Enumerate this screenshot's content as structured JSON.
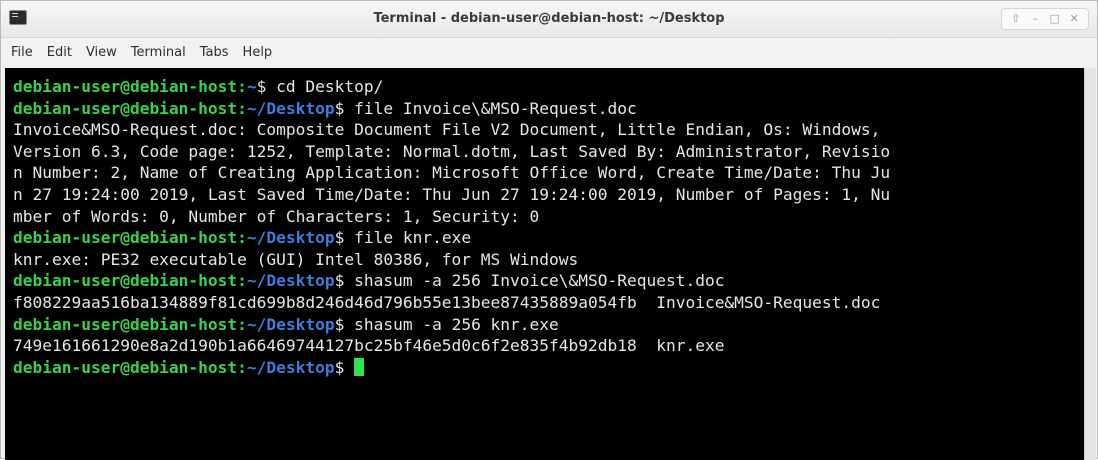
{
  "window": {
    "title": "Terminal - debian-user@debian-host: ~/Desktop",
    "controls": [
      "up-arrow-icon",
      "minimize-icon",
      "maximize-icon",
      "close-icon"
    ]
  },
  "menubar": {
    "items": [
      "File",
      "Edit",
      "View",
      "Terminal",
      "Tabs",
      "Help"
    ]
  },
  "terminal": {
    "colors": {
      "prompt_user": "#37d34a",
      "prompt_path": "#3a7fe0",
      "text": "#e6e6e6",
      "background": "#000000",
      "cursor": "#2fe54b"
    },
    "lines": [
      {
        "type": "prompt",
        "user": "debian-user@debian-host:",
        "path": "~",
        "cmd": "$ cd Desktop/"
      },
      {
        "type": "prompt",
        "user": "debian-user@debian-host:",
        "path": "~/Desktop",
        "cmd": "$ file Invoice\\&MSO-Request.doc"
      },
      {
        "type": "output",
        "text": "Invoice&MSO-Request.doc: Composite Document File V2 Document, Little Endian, Os: Windows,"
      },
      {
        "type": "output",
        "text": "Version 6.3, Code page: 1252, Template: Normal.dotm, Last Saved By: Administrator, Revisio"
      },
      {
        "type": "output",
        "text": "n Number: 2, Name of Creating Application: Microsoft Office Word, Create Time/Date: Thu Ju"
      },
      {
        "type": "output",
        "text": "n 27 19:24:00 2019, Last Saved Time/Date: Thu Jun 27 19:24:00 2019, Number of Pages: 1, Nu"
      },
      {
        "type": "output",
        "text": "mber of Words: 0, Number of Characters: 1, Security: 0"
      },
      {
        "type": "prompt",
        "user": "debian-user@debian-host:",
        "path": "~/Desktop",
        "cmd": "$ file knr.exe"
      },
      {
        "type": "output",
        "text": "knr.exe: PE32 executable (GUI) Intel 80386, for MS Windows"
      },
      {
        "type": "prompt",
        "user": "debian-user@debian-host:",
        "path": "~/Desktop",
        "cmd": "$ shasum -a 256 Invoice\\&MSO-Request.doc"
      },
      {
        "type": "output",
        "text": "f808229aa516ba134889f81cd699b8d246d46d796b55e13bee87435889a054fb  Invoice&MSO-Request.doc"
      },
      {
        "type": "prompt",
        "user": "debian-user@debian-host:",
        "path": "~/Desktop",
        "cmd": "$ shasum -a 256 knr.exe"
      },
      {
        "type": "output",
        "text": "749e161661290e8a2d190b1a66469744127bc25bf46e5d0c6f2e835f4b92db18  knr.exe"
      },
      {
        "type": "prompt",
        "user": "debian-user@debian-host:",
        "path": "~/Desktop",
        "cmd": "$ ",
        "cursor": true
      }
    ]
  }
}
